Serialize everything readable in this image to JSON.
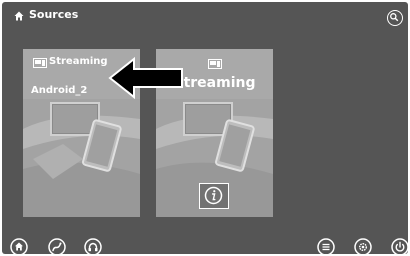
{
  "header": {
    "title": "Sources",
    "home_icon": "home-icon",
    "search_icon": "search-icon"
  },
  "sources": [
    {
      "label": "Streaming",
      "device": "Android_2",
      "icon": "streaming-source-icon"
    },
    {
      "label": "Streaming",
      "icon": "streaming-source-icon",
      "info_icon": "info-icon"
    }
  ],
  "bottom_bar": {
    "left": [
      "home-icon",
      "navigation-icon",
      "phone-icon"
    ],
    "right": [
      "menu-icon",
      "settings-icon",
      "power-icon"
    ]
  },
  "colors": {
    "background": "#555555",
    "card": "#a9a9a9",
    "text": "#ffffff",
    "arrow": "#000000"
  }
}
